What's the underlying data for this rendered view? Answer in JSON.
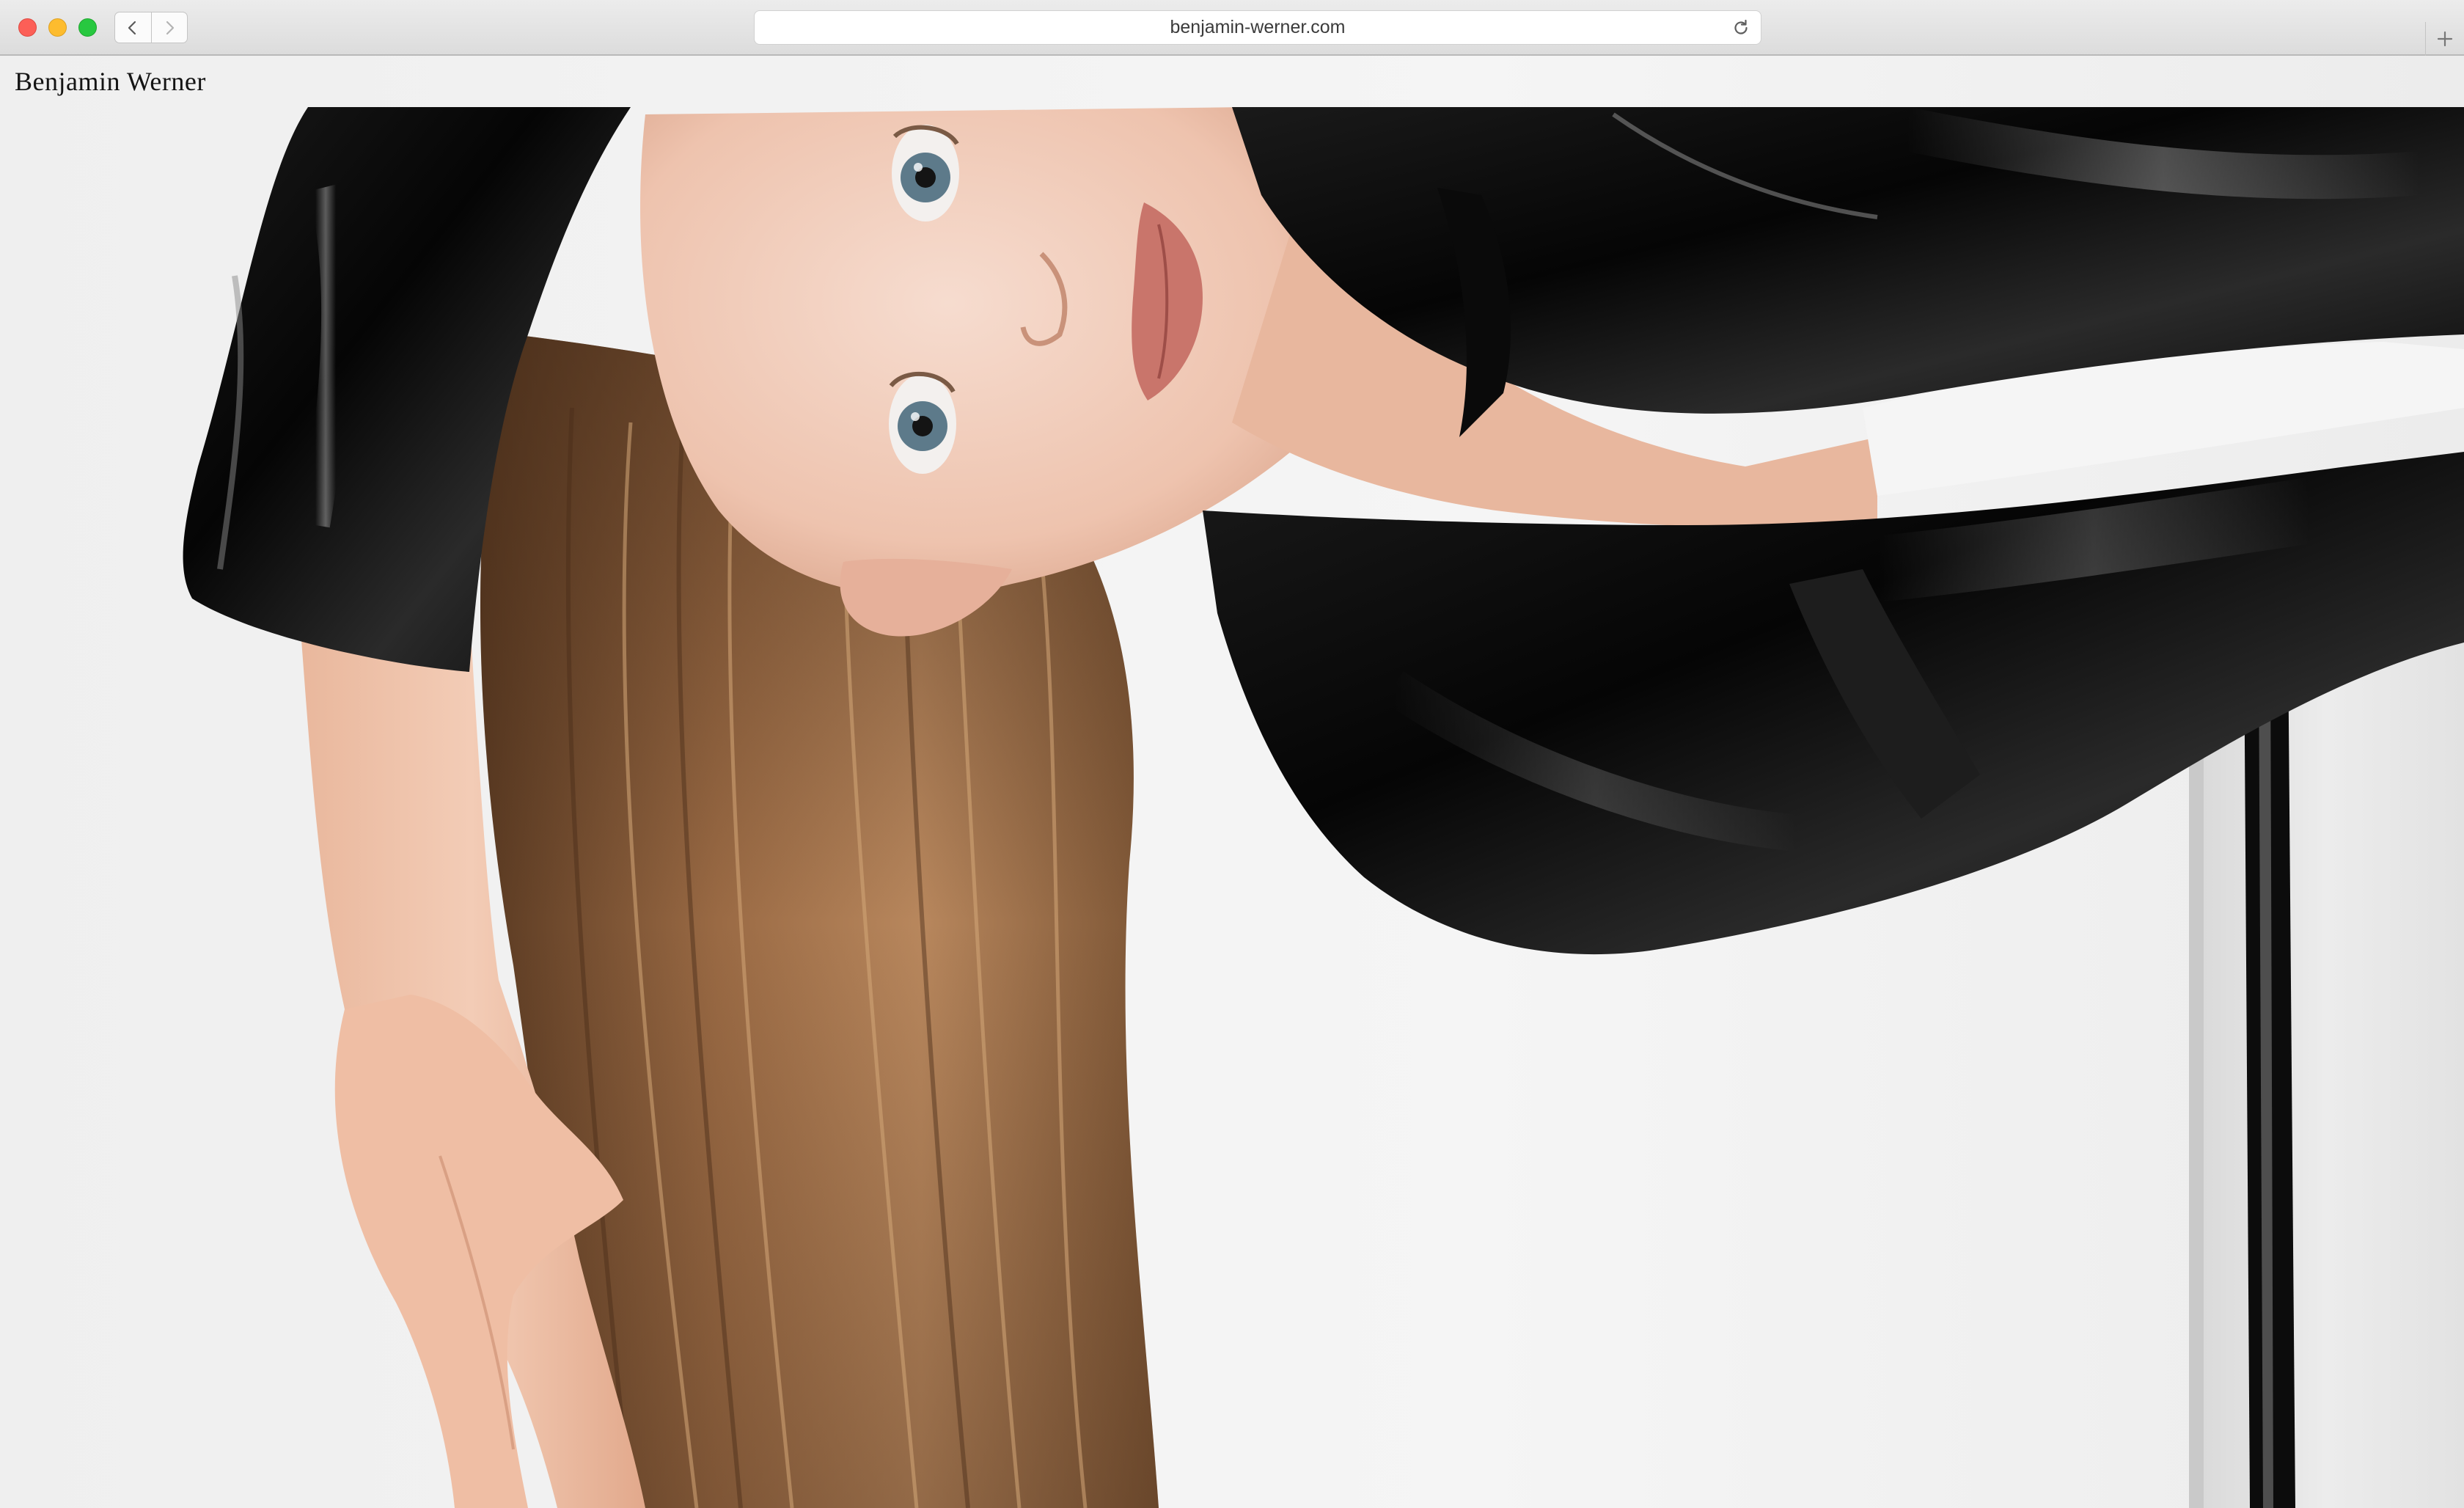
{
  "browser": {
    "url": "benjamin-werner.com"
  },
  "site": {
    "title": "Benjamin Werner"
  },
  "hero": {
    "alt": "Portrait photograph"
  },
  "icons": {
    "back": "chevron-left-icon",
    "forward": "chevron-right-icon",
    "reload": "reload-icon",
    "new_tab": "plus-icon"
  }
}
